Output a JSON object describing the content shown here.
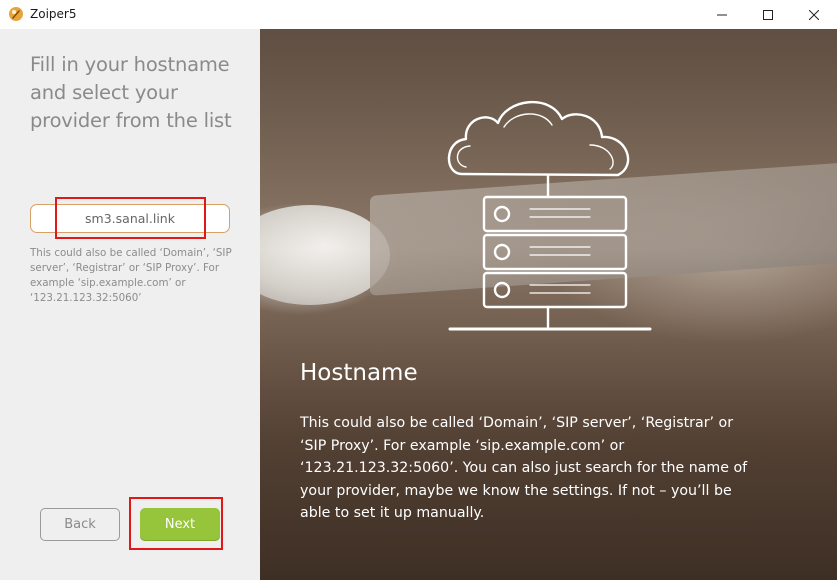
{
  "window": {
    "title": "Zoiper5",
    "controls": {
      "minimize": "minimize-icon",
      "maximize": "maximize-icon",
      "close": "close-icon"
    }
  },
  "left": {
    "instruction": "Fill in your hostname and select your provider from the list",
    "hostname_value": "sm3.sanal.link",
    "hint": "This could also be called ‘Domain’, ‘SIP server’, ‘Registrar’ or ‘SIP Proxy’. For example ‘sip.example.com’ or ‘123.21.123.32:5060’",
    "back_label": "Back",
    "next_label": "Next"
  },
  "right": {
    "heading": "Hostname",
    "body": "This could also be called ‘Domain’, ‘SIP server’, ‘Registrar’ or ‘SIP Proxy’. For example ‘sip.example.com’ or ‘123.21.123.32:5060’. You can also just search for the name of your provider, maybe we know the settings. If not – you’ll be able to set it up manually.",
    "illustration": "cloud-server-icon"
  },
  "colors": {
    "accent_green": "#96c43a",
    "input_border": "#d9a066",
    "highlight_red": "#e01818",
    "left_bg": "#efefef"
  }
}
